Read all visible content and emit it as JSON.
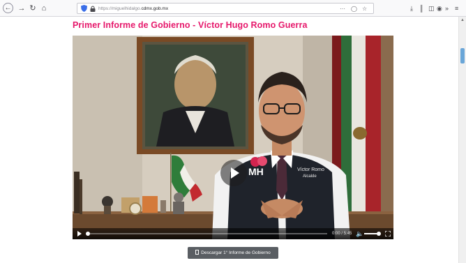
{
  "browser": {
    "url_prefix": "https://miguelhidalgo.",
    "url_domain": "cdmx.gob.mx",
    "icons": [
      "back-icon",
      "forward-icon",
      "reload-icon",
      "home-icon",
      "shield-icon",
      "lock-icon",
      "page-actions-icon",
      "pocket-icon",
      "bookmark-star-icon",
      "downloads-icon",
      "library-icon",
      "sidebar-icon",
      "account-icon",
      "overflow-icon",
      "menu-icon"
    ],
    "more_label": "···"
  },
  "page": {
    "title": "Primer Informe de Gobierno - Víctor Hugo Romo Guerra",
    "title_color": "#e6186b"
  },
  "video": {
    "time_current": "0:00",
    "time_total": "5:45",
    "time_separator": " / ",
    "vest_logo": "MH",
    "vest_name": "Víctor Romo",
    "vest_role": "Alcalde",
    "progress": 0.0,
    "volume": 0.85
  },
  "download": {
    "label": "Descargar 1° Informe de Gobierno"
  }
}
